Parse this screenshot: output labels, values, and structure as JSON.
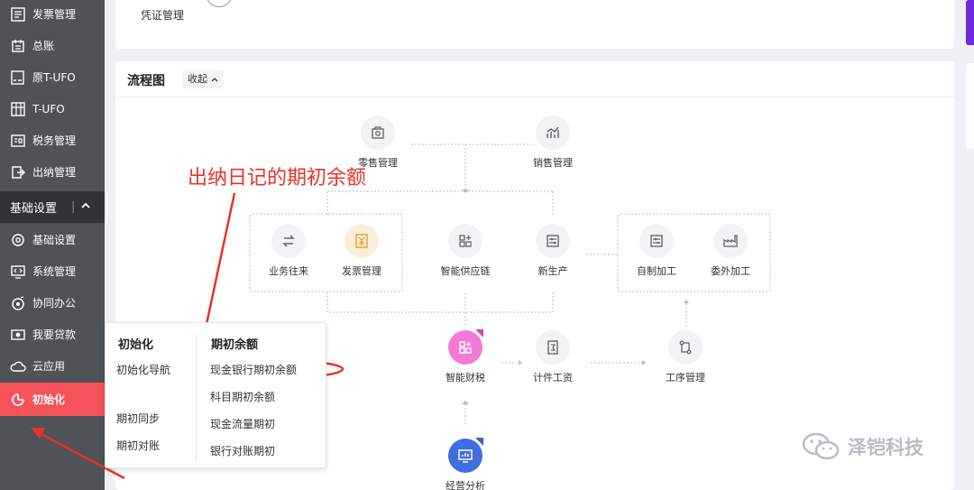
{
  "sidebar": {
    "items": [
      {
        "label": "发票管理",
        "icon": "invoice-icon"
      },
      {
        "label": "总账",
        "icon": "ledger-icon"
      },
      {
        "label": "原T-UFO",
        "icon": "ufo-report-icon"
      },
      {
        "label": "T-UFO",
        "icon": "report-table-icon"
      },
      {
        "label": "税务管理",
        "icon": "tax-icon"
      },
      {
        "label": "出纳管理",
        "icon": "cashier-icon"
      }
    ],
    "section": {
      "label": "基础设置",
      "separator": "|"
    },
    "sub_items": [
      {
        "label": "基础设置",
        "icon": "settings-gear-icon"
      },
      {
        "label": "系统管理",
        "icon": "monitor-code-icon"
      },
      {
        "label": "协同办公",
        "icon": "collaboration-icon"
      },
      {
        "label": "我要贷款",
        "icon": "loan-cash-icon"
      },
      {
        "label": "云应用",
        "icon": "cloud-icon"
      },
      {
        "label": "初始化",
        "icon": "init-chart-icon",
        "active": true
      }
    ]
  },
  "top_card": {
    "voucher_label": "凭证管理"
  },
  "flow": {
    "title": "流程图",
    "toggle_label": "收起",
    "nodes": {
      "retail": "零售管理",
      "sales": "销售管理",
      "business": "业务往来",
      "invoice": "发票管理",
      "supply": "智能供应链",
      "production": "新生产",
      "self_process": "自制加工",
      "outsource": "委外加工",
      "tax": "智能财税",
      "piece_wage": "计件工资",
      "process_mgmt": "工序管理",
      "analysis": "经营分析"
    }
  },
  "popup": {
    "left_title": "初始化",
    "left_items": [
      "初始化导航",
      "期初同步",
      "期初对账"
    ],
    "right_title": "期初余额",
    "right_items": [
      "现金银行期初余额",
      "科目期初余额",
      "现金流量期初",
      "银行对账期初"
    ]
  },
  "annotation": {
    "text": "出纳日记的期初余额",
    "color": "#e8322c"
  },
  "watermark": {
    "text": "泽铠科技"
  },
  "colors": {
    "sidebar_bg": "#4f5257",
    "active": "#f5525a",
    "section_bg": "#2f3236",
    "accent_purple": "#6e2bd8"
  }
}
